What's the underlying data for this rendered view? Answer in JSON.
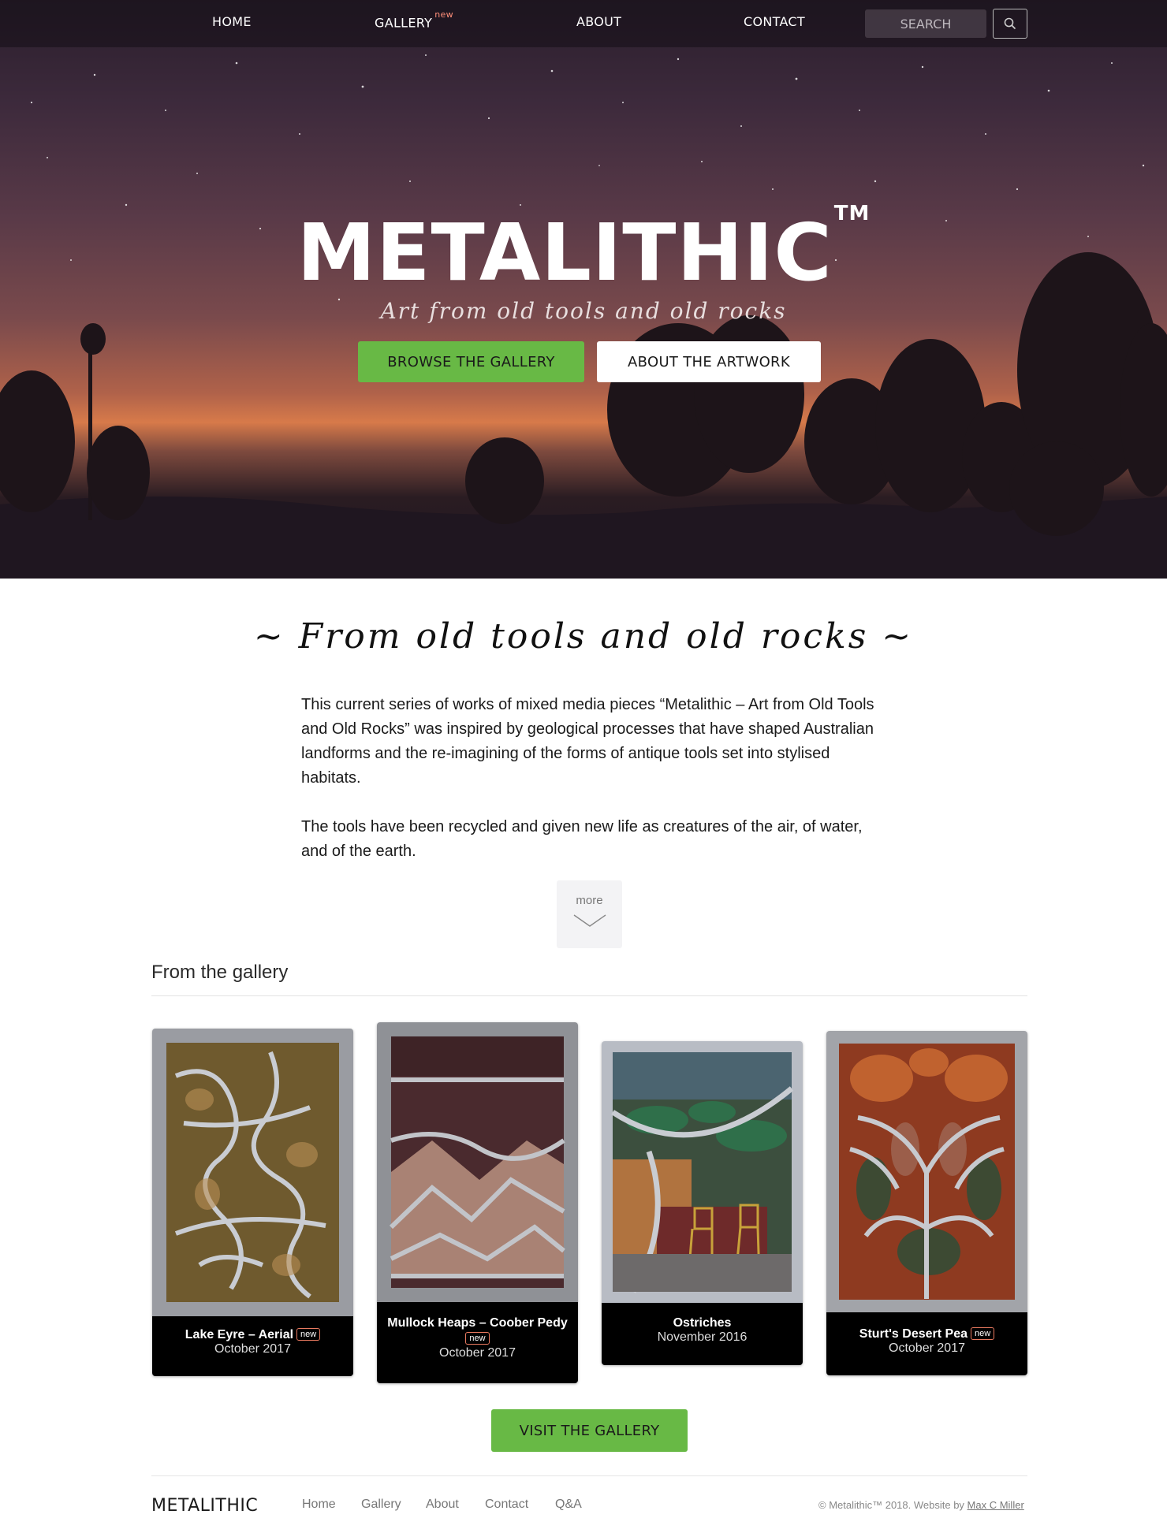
{
  "nav": {
    "home": "HOME",
    "gallery": "GALLERY",
    "gallery_badge": "new",
    "about": "ABOUT",
    "contact": "CONTACT",
    "search_placeholder": "SEARCH",
    "search_icon": "search-icon"
  },
  "hero": {
    "title": "METALITHIC",
    "trademark": "TM",
    "subtitle": "Art from old tools and old rocks",
    "browse_button": "BROWSE THE GALLERY",
    "about_button": "ABOUT THE ARTWORK"
  },
  "intro": {
    "heading": "~ From old tools and old rocks ~",
    "paragraph1": "This current series of works of mixed media pieces “Metalithic – Art from Old Tools and Old Rocks” was inspired by geological processes that have shaped Australian landforms and the re-imagining of the forms of antique tools set into stylised habitats.",
    "paragraph2": "The tools have been recycled and given new life as creatures of the air, of water, and of the earth.",
    "more_label": "more",
    "more_icon": "chevron-down-icon"
  },
  "gallery": {
    "heading": "From the gallery",
    "items": [
      {
        "title": "Lake Eyre – Aerial",
        "badge": "new",
        "date": "October 2017"
      },
      {
        "title": "Mullock Heaps – Coober Pedy",
        "badge": "new",
        "date": "October 2017"
      },
      {
        "title": "Ostriches",
        "badge": "",
        "date": "November 2016"
      },
      {
        "title": "Sturt's Desert Pea",
        "badge": "new",
        "date": "October 2017"
      }
    ],
    "visit_button": "VISIT THE GALLERY"
  },
  "footer": {
    "logo": "METALITHIC",
    "links": [
      "Home",
      "Gallery",
      "About",
      "Contact",
      "Q&A"
    ],
    "copyright": "© Metalithic™ 2018. Website by",
    "author": "Max C Miller"
  },
  "colors": {
    "accent_green": "#68b945",
    "badge_outline": "#e8795f",
    "nav_badge": "#ff8f7a"
  }
}
